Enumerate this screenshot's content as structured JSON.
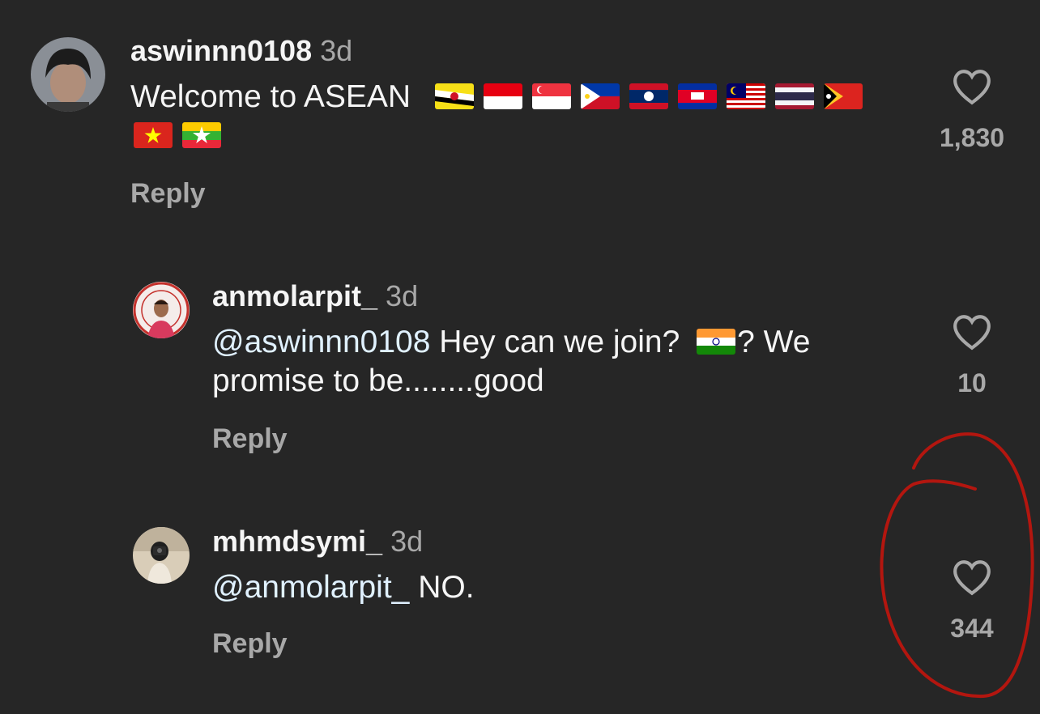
{
  "comments": [
    {
      "username": "aswinnn0108",
      "time": "3d",
      "text": "Welcome to ASEAN",
      "flags": [
        "flag-brunei",
        "flag-indonesia",
        "flag-singapore",
        "flag-philippines",
        "flag-laos",
        "flag-cambodia",
        "flag-malaysia",
        "flag-thailand",
        "flag-timor-leste",
        "flag-vietnam",
        "flag-myanmar"
      ],
      "reply_label": "Reply",
      "likes": "1,830"
    },
    {
      "username": "anmolarpit_",
      "time": "3d",
      "mention": "@aswinnn0108",
      "text_before_flag": " Hey can we join?",
      "flag": "flag-india",
      "text_after_flag": "? We",
      "text_line2": "promise to be........good",
      "reply_label": "Reply",
      "likes": "10"
    },
    {
      "username": "mhmdsymi_",
      "time": "3d",
      "mention": "@anmolarpit_",
      "text": " NO.",
      "reply_label": "Reply",
      "likes": "344"
    }
  ],
  "icons": {
    "like": "heart-outline-icon"
  },
  "colors": {
    "background": "#262626",
    "annotation": "#b3160f",
    "secondary": "#a8a8a8"
  }
}
